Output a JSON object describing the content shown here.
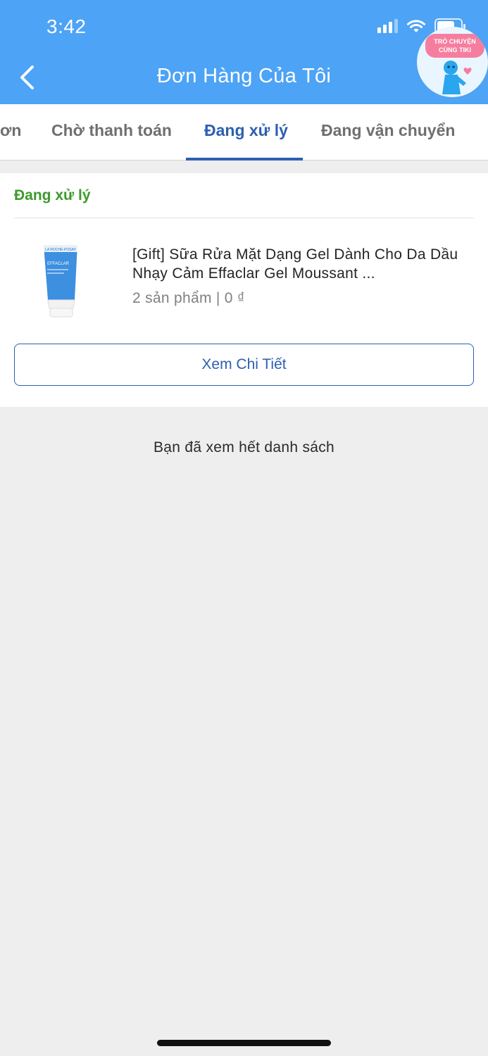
{
  "status_bar": {
    "time": "3:42"
  },
  "header": {
    "title": "Đơn Hàng Của Tôi",
    "chat_label_line1": "TRÒ CHUYỆN",
    "chat_label_line2": "CÙNG TIKI"
  },
  "tabs": [
    {
      "label": "ơn",
      "active": false
    },
    {
      "label": "Chờ thanh toán",
      "active": false
    },
    {
      "label": "Đang xử lý",
      "active": true
    },
    {
      "label": "Đang vận chuyển",
      "active": false
    }
  ],
  "order": {
    "status": "Đang xử lý",
    "product_name": "[Gift] Sữa Rửa Mặt Dạng Gel Dành Cho Da Dầu Nhạy Cảm Effaclar Gel Moussant ...",
    "product_meta": "2 sản phẩm | 0 ₫",
    "detail_button": "Xem Chi Tiết",
    "thumb_brand": "LA ROCHE-POSAY",
    "thumb_product": "EFFACLAR"
  },
  "list_end_text": "Bạn đã xem hết danh sách",
  "colors": {
    "header_bg": "#4da3f5",
    "active_tab": "#2d5fb0",
    "status_green": "#3c9a2a"
  }
}
